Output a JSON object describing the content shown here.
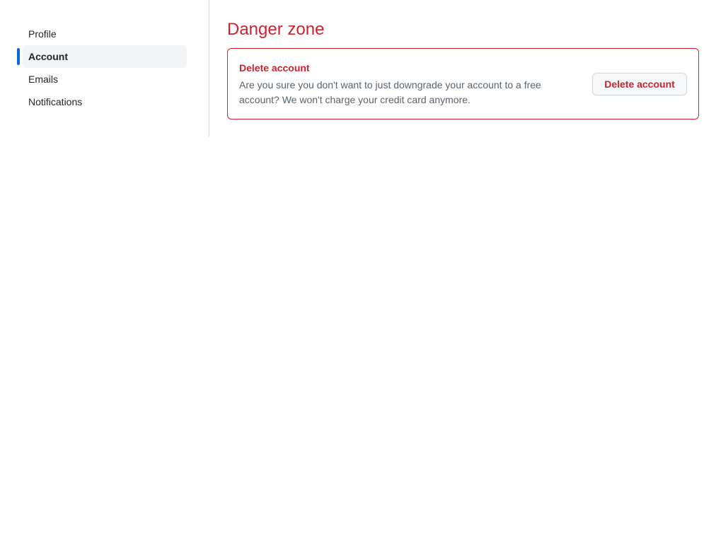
{
  "sidebar": {
    "items": [
      {
        "label": "Profile",
        "active": false
      },
      {
        "label": "Account",
        "active": true
      },
      {
        "label": "Emails",
        "active": false
      },
      {
        "label": "Notifications",
        "active": false
      }
    ]
  },
  "main": {
    "title": "Danger zone",
    "danger": {
      "title": "Delete account",
      "description": "Are you sure you don't want to just downgrade your account to a free account? We won't charge your credit card anymore.",
      "button_label": "Delete account"
    }
  },
  "colors": {
    "danger": "#cf222e",
    "accent": "#0969da",
    "active_background": "#f3f4f6",
    "border": "#d0d7de"
  }
}
